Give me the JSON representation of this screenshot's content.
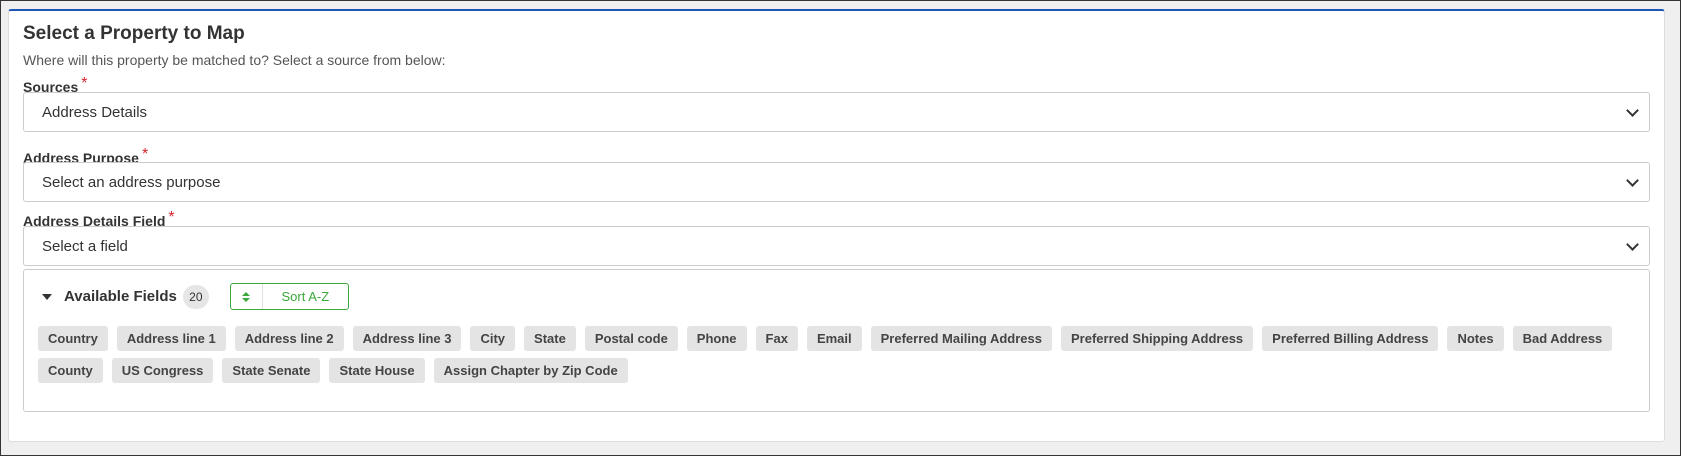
{
  "header": {
    "title": "Select a Property to Map",
    "subtitle": "Where will this property be matched to? Select a source from below:"
  },
  "sources": {
    "label": "Sources",
    "value": "Address Details"
  },
  "address_purpose": {
    "label": "Address Purpose",
    "value": "Select an address purpose"
  },
  "address_details_field": {
    "label": "Address Details Field",
    "value": "Select a field"
  },
  "required_mark": "*",
  "available_fields": {
    "title": "Available Fields",
    "count": "20",
    "sort_label": "Sort A-Z",
    "row1": [
      "Country",
      "Address line 1",
      "Address line 2",
      "Address line 3",
      "City",
      "State",
      "Postal code",
      "Phone",
      "Fax",
      "Email",
      "Preferred Mailing Address",
      "Preferred Shipping Address",
      "Preferred Billing Address",
      "Notes",
      "Bad Address"
    ],
    "row2": [
      "County",
      "US Congress",
      "State Senate",
      "State House",
      "Assign Chapter by Zip Code"
    ]
  },
  "colors": {
    "accent_border": "#1a56b8",
    "sort_green": "#3aa83a",
    "required_red": "#d9232d"
  }
}
